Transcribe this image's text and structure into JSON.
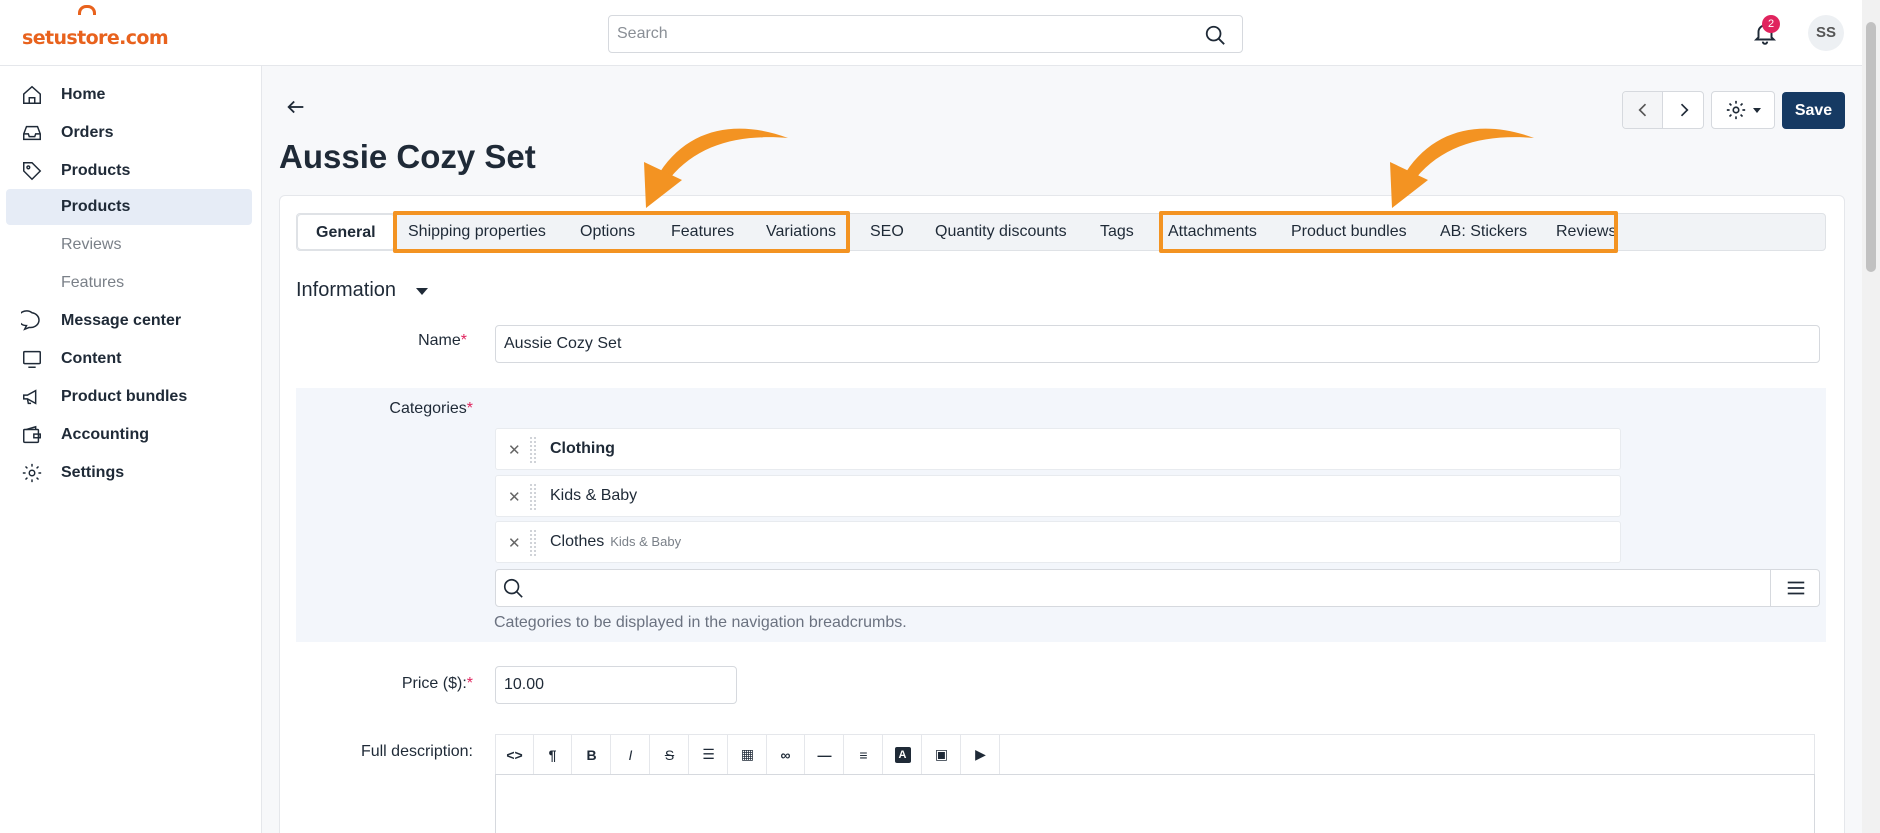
{
  "brand": {
    "logo_text": "setustore.com",
    "accent": "#e8621d"
  },
  "header": {
    "search_placeholder": "Search",
    "notifications_count": "2",
    "user_initials": "SS"
  },
  "sidebar": {
    "items": [
      {
        "label": "Home",
        "icon": "home-icon"
      },
      {
        "label": "Orders",
        "icon": "inbox-icon"
      },
      {
        "label": "Products",
        "icon": "tag-icon"
      },
      {
        "label": "Products"
      },
      {
        "label": "Reviews"
      },
      {
        "label": "Features"
      },
      {
        "label": "Message center",
        "icon": "chat-icon"
      },
      {
        "label": "Content",
        "icon": "monitor-icon"
      },
      {
        "label": "Product bundles",
        "icon": "megaphone-icon"
      },
      {
        "label": "Accounting",
        "icon": "wallet-icon"
      },
      {
        "label": "Settings",
        "icon": "gear-icon"
      }
    ]
  },
  "page": {
    "title": "Aussie Cozy Set",
    "save_label": "Save"
  },
  "tabs": [
    "General",
    "Shipping properties",
    "Options",
    "Features",
    "Variations",
    "SEO",
    "Quantity discounts",
    "Tags",
    "Attachments",
    "Product bundles",
    "AB: Stickers",
    "Reviews"
  ],
  "highlight_color": "#f39322",
  "form": {
    "section_title": "Information",
    "name_label": "Name",
    "name_value": "Aussie Cozy Set",
    "categories_label": "Categories",
    "categories": [
      {
        "name": "Clothing",
        "parent": ""
      },
      {
        "name": "Kids & Baby",
        "parent": ""
      },
      {
        "name": "Clothes",
        "parent": "Kids & Baby"
      }
    ],
    "categories_help": "Categories to be displayed in the navigation breadcrumbs.",
    "price_label": "Price ($):",
    "price_value": "10.00",
    "description_label": "Full description:",
    "required_mark": "*"
  }
}
